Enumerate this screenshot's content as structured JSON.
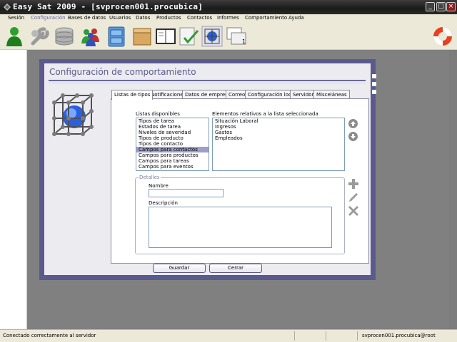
{
  "window": {
    "title": "Easy Sat 2009 - [svprocen001.procubica]",
    "minimize_glyph": "_",
    "maximize_glyph": "□",
    "close_glyph": "×"
  },
  "menu": [
    {
      "label": "Sesión"
    },
    {
      "label": "Configuración"
    },
    {
      "label": "Bases de datos"
    },
    {
      "label": "Usuarios"
    },
    {
      "label": "Datos"
    },
    {
      "label": "Productos"
    },
    {
      "label": "Contactos"
    },
    {
      "label": "Informes"
    },
    {
      "label": "Comportamiento"
    },
    {
      "label": "Ayuda"
    }
  ],
  "toolbar_icons": [
    "user-icon",
    "wrench-icon",
    "database-icon",
    "users-icon",
    "filing-cabinet-icon",
    "box-icon",
    "book-icon",
    "checklist-icon",
    "cube-network-icon",
    "windows-icon",
    "lifebuoy-icon"
  ],
  "dialog": {
    "title": "Configuración de comportamiento",
    "tabs": [
      {
        "label": "Listas de tipos"
      },
      {
        "label": "Notificaciones"
      },
      {
        "label": "Datos de empresa"
      },
      {
        "label": "Correo"
      },
      {
        "label": "Configuración local"
      },
      {
        "label": "Servidor"
      },
      {
        "label": "Misceláneas"
      }
    ],
    "available_lists_label": "Listas disponibles",
    "available_lists": [
      "Tipos de tarea",
      "Estados de tarea",
      "Niveles de severidad",
      "Tipos de producto",
      "Tipos de contacto",
      "Campos para contactos",
      "Campos para productos",
      "Campos para tareas",
      "Campos para eventos"
    ],
    "selected_list_index": 5,
    "elements_label": "Elementos relativos a la lista seleccionada",
    "elements": [
      "Situación Laboral",
      "Ingresos",
      "Gastos",
      "Empleados"
    ],
    "details_legend": "Detalles",
    "name_label": "Nombre",
    "name_value": "",
    "description_label": "Descripción",
    "description_value": "",
    "save_label": "Guardar",
    "close_label": "Cerrar"
  },
  "statusbar": {
    "message": "Conectado correctamente al servidor",
    "user": "svprocen001.procubica@root"
  },
  "colors": {
    "dialog_frame": "#5a5a8e",
    "selection": "#9e9ec8",
    "workspace": "#808080"
  }
}
